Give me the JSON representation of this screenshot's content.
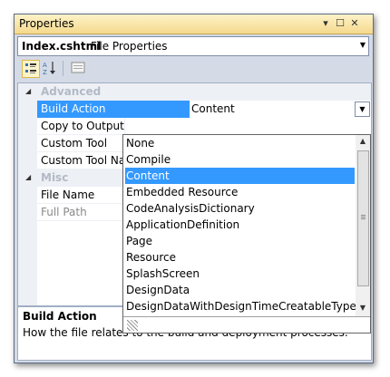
{
  "window": {
    "title": "Properties",
    "buttons": {
      "menu": "▾",
      "maximize": "☐",
      "close": "✕"
    }
  },
  "file_selector": {
    "name": "Index.cshtml",
    "description": "File Properties"
  },
  "toolbar": {
    "categorized_icon": "categorized-icon",
    "alphabetical_icon": "alphabetical-icon",
    "property_pages_icon": "property-pages-icon"
  },
  "grid": {
    "categories": [
      {
        "label": "Advanced"
      },
      {
        "label": "Misc"
      }
    ],
    "properties": [
      {
        "label": "Build Action",
        "value": "Content"
      },
      {
        "label": "Copy to Output Directory",
        "value": ""
      },
      {
        "label": "Custom Tool",
        "value": ""
      },
      {
        "label": "Custom Tool Namespace",
        "value": ""
      },
      {
        "label": "File Name",
        "value": ""
      },
      {
        "label": "Full Path",
        "value": ""
      }
    ]
  },
  "dropdown": {
    "options": [
      "None",
      "Compile",
      "Content",
      "Embedded Resource",
      "CodeAnalysisDictionary",
      "ApplicationDefinition",
      "Page",
      "Resource",
      "SplashScreen",
      "DesignData",
      "DesignDataWithDesignTimeCreatableTypes"
    ],
    "selected_index": 2
  },
  "help": {
    "title": "Build Action",
    "description": "How the file relates to the build and deployment processes."
  }
}
